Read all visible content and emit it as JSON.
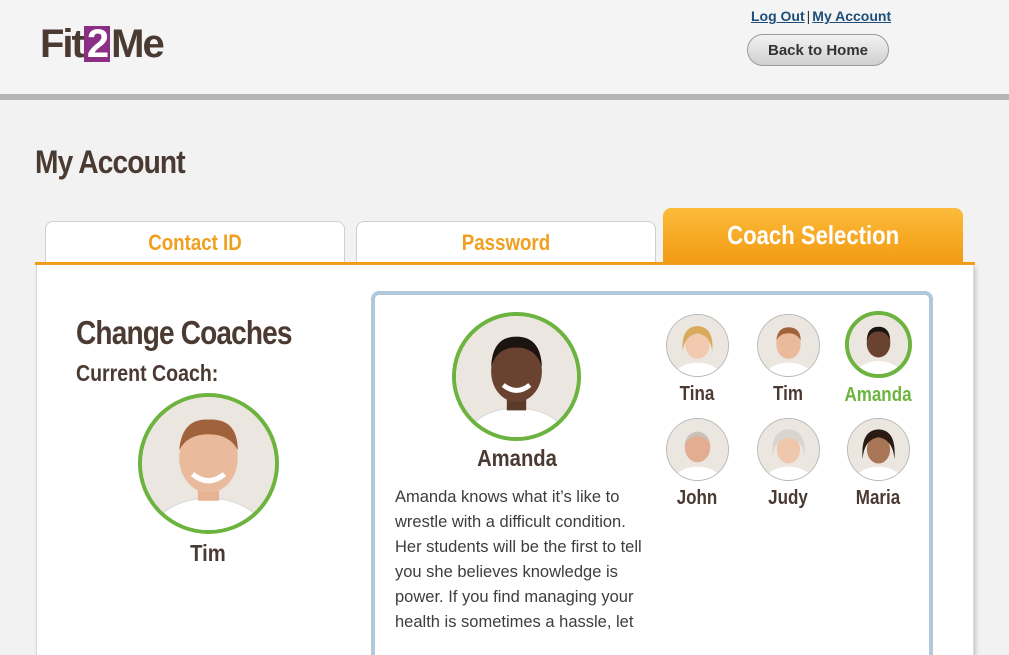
{
  "header": {
    "logo_pre": "Fit",
    "logo_mid": "2",
    "logo_post": "Me",
    "logout_label": "Log Out",
    "separator": "|",
    "my_account_label": "My Account",
    "back_home_label": "Back to Home"
  },
  "page": {
    "title": "My Account"
  },
  "tabs": [
    {
      "label": "Contact ID",
      "active": false
    },
    {
      "label": "Password",
      "active": false
    },
    {
      "label": "Coach Selection",
      "active": true
    }
  ],
  "left": {
    "title": "Change Coaches",
    "current_label": "Current Coach:",
    "current_coach": "Tim"
  },
  "selected": {
    "name": "Amanda",
    "bio": "Amanda knows what it’s like to wrestle with a difficult condition. Her students will be the first to tell you she believes knowledge is power. If you find managing your health is sometimes a hassle, let"
  },
  "coaches": [
    {
      "name": "Tina",
      "active": false
    },
    {
      "name": "Tim",
      "active": false
    },
    {
      "name": "Amanda",
      "active": true
    },
    {
      "name": "John",
      "active": false
    },
    {
      "name": "Judy",
      "active": false
    },
    {
      "name": "Maria",
      "active": false
    }
  ],
  "colors": {
    "accent_orange": "#f39a12",
    "selected_green": "#6db33f",
    "link_blue": "#1e4e78",
    "brand_purple": "#8b2f86"
  }
}
